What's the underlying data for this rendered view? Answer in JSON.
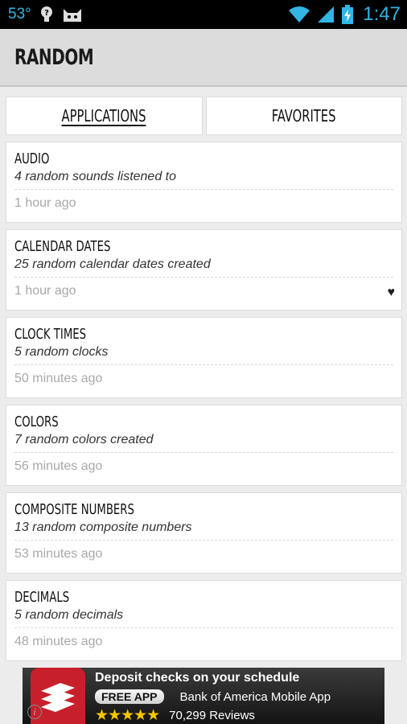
{
  "status_bar": {
    "temperature": "53°",
    "time": "1:47",
    "icons": [
      "info-bulb-icon",
      "android-cat-icon",
      "wifi-icon",
      "signal-icon",
      "battery-charging-icon"
    ],
    "accent_color": "#33b5e5"
  },
  "header": {
    "title": "RANDOM"
  },
  "tabs": [
    {
      "label": "APPLICATIONS",
      "active": true
    },
    {
      "label": "FAVORITES",
      "active": false
    }
  ],
  "items": [
    {
      "title": "AUDIO",
      "subtitle": "4 random sounds listened to",
      "time": "1 hour ago",
      "favorite": false
    },
    {
      "title": "CALENDAR DATES",
      "subtitle": "25 random calendar dates created",
      "time": "1 hour ago",
      "favorite": true
    },
    {
      "title": "CLOCK TIMES",
      "subtitle": "5 random clocks",
      "time": "50 minutes ago",
      "favorite": false
    },
    {
      "title": "COLORS",
      "subtitle": "7 random colors created",
      "time": "56 minutes ago",
      "favorite": false
    },
    {
      "title": "COMPOSITE NUMBERS",
      "subtitle": "13 random composite numbers",
      "time": "53 minutes ago",
      "favorite": false
    },
    {
      "title": "DECIMALS",
      "subtitle": "5 random decimals",
      "time": "48 minutes ago",
      "favorite": false
    }
  ],
  "ad": {
    "headline": "Deposit checks on your schedule",
    "cta": "FREE APP",
    "app_name": "Bank of America Mobile App",
    "rating_stars": 4.5,
    "reviews": "70,299 Reviews",
    "brand_color": "#c8202b",
    "info_icon": "info-icon"
  }
}
